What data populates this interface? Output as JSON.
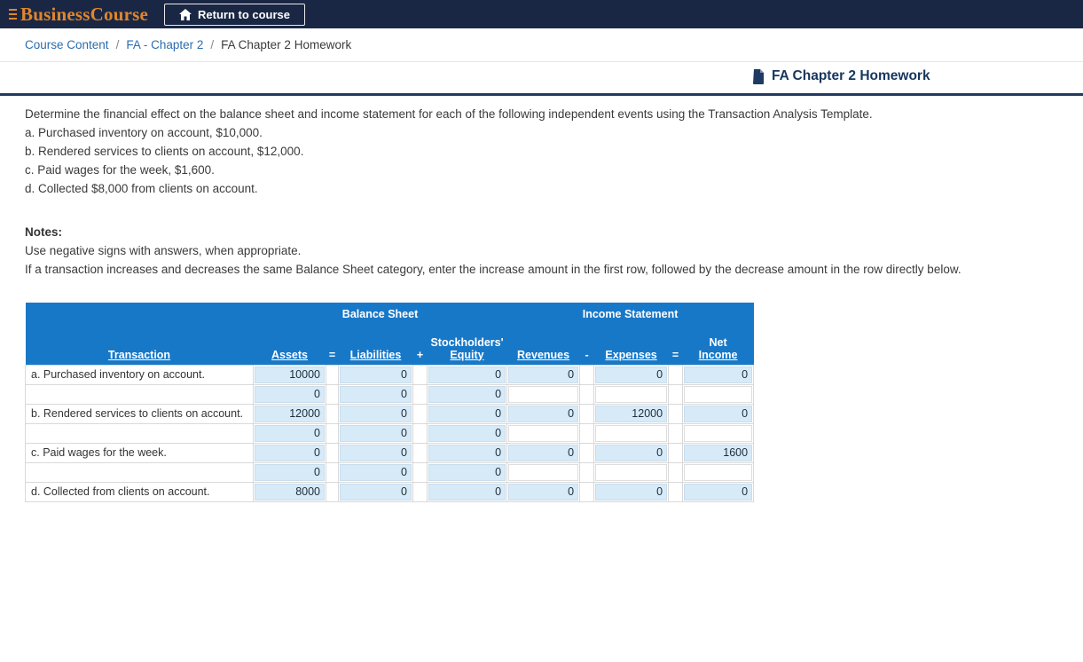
{
  "navbar": {
    "brand": "BusinessCourse",
    "return_button": "Return to course"
  },
  "breadcrumb": {
    "separator": "/",
    "items": [
      {
        "label": "Course Content"
      },
      {
        "label": "FA - Chapter 2"
      },
      {
        "label": "FA Chapter 2 Homework"
      }
    ]
  },
  "page": {
    "title": "FA Chapter 2 Homework"
  },
  "instructions": {
    "intro": "Determine the financial effect on the balance sheet and income statement for each of the following independent events using the Transaction Analysis Template.",
    "items": [
      "a. Purchased inventory on account, $10,000.",
      "b. Rendered services to clients on account, $12,000.",
      "c. Paid wages for the week, $1,600.",
      "d. Collected $8,000 from clients on account."
    ],
    "notes_label": "Notes:",
    "notes": [
      "Use negative signs with answers, when appropriate.",
      "If a transaction increases and decreases the same Balance Sheet category, enter the increase amount in the first row, followed by the decrease amount in the row directly below."
    ]
  },
  "table": {
    "headers": {
      "balance_sheet": "Balance Sheet",
      "income_statement": "Income Statement",
      "transaction": "Transaction",
      "assets": "Assets",
      "equals_1": "=",
      "liabilities": "Liabilities",
      "plus": "+",
      "stockholders": "Stockholders'",
      "equity": "Equity",
      "revenues": "Revenues",
      "minus": "-",
      "expenses": "Expenses",
      "equals_2": "=",
      "net": "Net",
      "income": "Income"
    },
    "rows": [
      {
        "transaction": "a. Purchased inventory on account.",
        "assets": "10000",
        "liabilities": "0",
        "equity": "0",
        "revenues": "0",
        "expenses": "0",
        "net_income": "0",
        "income_statement_inputs": true
      },
      {
        "transaction": "",
        "assets": "0",
        "liabilities": "0",
        "equity": "0",
        "revenues": "",
        "expenses": "",
        "net_income": "",
        "income_statement_inputs": false
      },
      {
        "transaction": "b. Rendered services to clients on account.",
        "assets": "12000",
        "liabilities": "0",
        "equity": "0",
        "revenues": "0",
        "expenses": "12000",
        "net_income": "0",
        "income_statement_inputs": true
      },
      {
        "transaction": "",
        "assets": "0",
        "liabilities": "0",
        "equity": "0",
        "revenues": "",
        "expenses": "",
        "net_income": "",
        "income_statement_inputs": false
      },
      {
        "transaction": "c. Paid wages for the week.",
        "assets": "0",
        "liabilities": "0",
        "equity": "0",
        "revenues": "0",
        "expenses": "0",
        "net_income": "1600",
        "income_statement_inputs": true
      },
      {
        "transaction": "",
        "assets": "0",
        "liabilities": "0",
        "equity": "0",
        "revenues": "",
        "expenses": "",
        "net_income": "",
        "income_statement_inputs": false
      },
      {
        "transaction": "d. Collected from clients on account.",
        "assets": "8000",
        "liabilities": "0",
        "equity": "0",
        "revenues": "0",
        "expenses": "0",
        "net_income": "0",
        "income_statement_inputs": true
      }
    ]
  }
}
